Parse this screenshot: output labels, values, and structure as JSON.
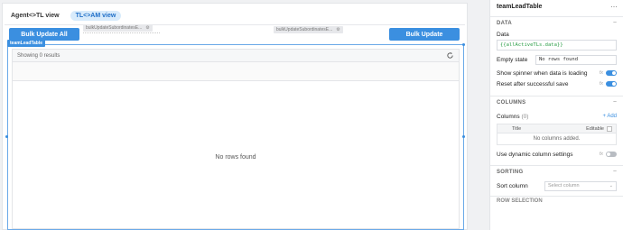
{
  "canvas": {
    "tabs": [
      "Agent<>TL view",
      "TL<>AM view"
    ],
    "buttons": {
      "bulk_update_all": "Bulk Update All",
      "bulk_update": "Bulk Update"
    },
    "queries": [
      "bulkUpdateSubordinatesE...",
      "bulkUpdateSubordinatesE..."
    ],
    "table": {
      "widget_label": "teamLeadTable",
      "showing_text": "Showing 0 results",
      "empty_text": "No rows found"
    }
  },
  "panel": {
    "title": "teamLeadTable",
    "sections": {
      "data": "DATA",
      "columns": "COLUMNS",
      "sorting": "SORTING",
      "cut_off": "ROW SELECTION"
    },
    "data": {
      "data_label": "Data",
      "data_value": "{{allActiveTLs.data}}",
      "empty_state_label": "Empty state",
      "empty_state_value": "No rows found",
      "spinner_label": "Show spinner when data is loading",
      "reset_label": "Reset after successful save",
      "fx": "fx"
    },
    "columns": {
      "columns_label": "Columns",
      "columns_count": "(0)",
      "add_label": "+ Add",
      "col_title_header": "Title",
      "col_editable_header": "Editable",
      "empty": "No columns added.",
      "dynamic_label": "Use dynamic column settings"
    },
    "sorting": {
      "sort_label": "Sort column",
      "sort_placeholder": "Select column"
    }
  },
  "colors": {
    "accent": "#3b8fe0",
    "code": "#2a9d46"
  },
  "toggles": {
    "show_spinner": true,
    "reset_after_save": true,
    "dynamic_columns": false
  }
}
